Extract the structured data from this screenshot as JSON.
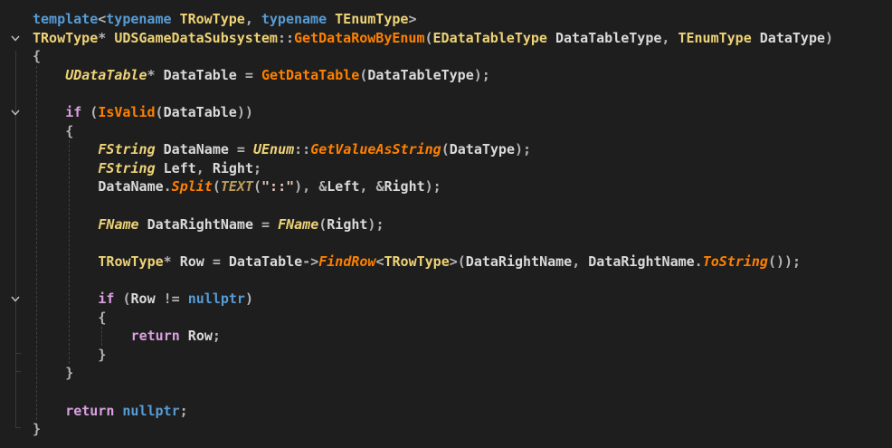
{
  "editor": {
    "fold_icon": "chevron-down-icon",
    "lines": [
      {
        "tokens": [
          [
            "kw",
            "template"
          ],
          [
            "punct",
            "<"
          ],
          [
            "kw",
            "typename"
          ],
          [
            "var",
            " "
          ],
          [
            "type",
            "TRowType"
          ],
          [
            "punct",
            ", "
          ],
          [
            "kw",
            "typename"
          ],
          [
            "var",
            " "
          ],
          [
            "type",
            "TEnumType"
          ],
          [
            "punct",
            ">"
          ]
        ]
      },
      {
        "tokens": [
          [
            "type",
            "TRowType"
          ],
          [
            "punct",
            "* "
          ],
          [
            "type",
            "UDSGameDataSubsystem"
          ],
          [
            "punct",
            "::"
          ],
          [
            "fn",
            "GetDataRowByEnum"
          ],
          [
            "punct",
            "("
          ],
          [
            "type",
            "EDataTableType"
          ],
          [
            "var",
            " DataTableType"
          ],
          [
            "punct",
            ", "
          ],
          [
            "type",
            "TEnumType"
          ],
          [
            "var",
            " DataType"
          ],
          [
            "punct",
            ")"
          ]
        ]
      },
      {
        "tokens": [
          [
            "punct",
            "{"
          ]
        ]
      },
      {
        "tokens": [
          [
            "type-i",
            "UDataTable"
          ],
          [
            "punct",
            "* "
          ],
          [
            "var",
            "DataTable "
          ],
          [
            "punct",
            "= "
          ],
          [
            "fn",
            "GetDataTable"
          ],
          [
            "punct",
            "("
          ],
          [
            "var",
            "DataTableType"
          ],
          [
            "punct",
            ");"
          ]
        ]
      },
      {
        "tokens": []
      },
      {
        "tokens": [
          [
            "ctl",
            "if"
          ],
          [
            "punct",
            " ("
          ],
          [
            "fn",
            "IsValid"
          ],
          [
            "punct",
            "("
          ],
          [
            "var",
            "DataTable"
          ],
          [
            "punct",
            "))"
          ]
        ]
      },
      {
        "tokens": [
          [
            "punct",
            "{"
          ]
        ]
      },
      {
        "tokens": [
          [
            "type-i",
            "FString"
          ],
          [
            "var",
            " DataName "
          ],
          [
            "punct",
            "= "
          ],
          [
            "type-i",
            "UEnum"
          ],
          [
            "punct",
            "::"
          ],
          [
            "mth-i",
            "GetValueAsString"
          ],
          [
            "punct",
            "("
          ],
          [
            "var",
            "DataType"
          ],
          [
            "punct",
            ");"
          ]
        ]
      },
      {
        "tokens": [
          [
            "type-i",
            "FString"
          ],
          [
            "var",
            " Left"
          ],
          [
            "punct",
            ", "
          ],
          [
            "var",
            "Right"
          ],
          [
            "punct",
            ";"
          ]
        ]
      },
      {
        "tokens": [
          [
            "var",
            "DataName"
          ],
          [
            "punct",
            "."
          ],
          [
            "mth-i",
            "Split"
          ],
          [
            "punct",
            "("
          ],
          [
            "macro-i",
            "TEXT"
          ],
          [
            "punct",
            "("
          ],
          [
            "str",
            "\"::\""
          ],
          [
            "punct",
            "), &"
          ],
          [
            "var",
            "Left"
          ],
          [
            "punct",
            ", &"
          ],
          [
            "var",
            "Right"
          ],
          [
            "punct",
            ");"
          ]
        ]
      },
      {
        "tokens": []
      },
      {
        "tokens": [
          [
            "type-i",
            "FName"
          ],
          [
            "var",
            " DataRightName "
          ],
          [
            "punct",
            "= "
          ],
          [
            "type-i",
            "FName"
          ],
          [
            "punct",
            "("
          ],
          [
            "var",
            "Right"
          ],
          [
            "punct",
            ");"
          ]
        ]
      },
      {
        "tokens": []
      },
      {
        "tokens": [
          [
            "type",
            "TRowType"
          ],
          [
            "punct",
            "* "
          ],
          [
            "var",
            "Row "
          ],
          [
            "punct",
            "= "
          ],
          [
            "var",
            "DataTable"
          ],
          [
            "punct",
            "->"
          ],
          [
            "mth-i",
            "FindRow"
          ],
          [
            "punct",
            "<"
          ],
          [
            "type",
            "TRowType"
          ],
          [
            "punct",
            ">("
          ],
          [
            "var",
            "DataRightName"
          ],
          [
            "punct",
            ", "
          ],
          [
            "var",
            "DataRightName"
          ],
          [
            "punct",
            "."
          ],
          [
            "mth-i",
            "ToString"
          ],
          [
            "punct",
            "());"
          ]
        ]
      },
      {
        "tokens": []
      },
      {
        "tokens": [
          [
            "ctl",
            "if"
          ],
          [
            "punct",
            " ("
          ],
          [
            "var",
            "Row "
          ],
          [
            "punct",
            "!= "
          ],
          [
            "kw",
            "nullptr"
          ],
          [
            "punct",
            ")"
          ]
        ]
      },
      {
        "tokens": [
          [
            "punct",
            "{"
          ]
        ]
      },
      {
        "tokens": [
          [
            "ctl",
            "return"
          ],
          [
            "var",
            " Row"
          ],
          [
            "punct",
            ";"
          ]
        ]
      },
      {
        "tokens": [
          [
            "punct",
            "}"
          ]
        ]
      },
      {
        "tokens": [
          [
            "punct",
            "}"
          ]
        ]
      },
      {
        "tokens": []
      },
      {
        "tokens": [
          [
            "ctl",
            "return"
          ],
          [
            "var",
            " "
          ],
          [
            "kw",
            "nullptr"
          ],
          [
            "punct",
            ";"
          ]
        ]
      },
      {
        "tokens": [
          [
            "punct",
            "}"
          ]
        ]
      }
    ]
  }
}
